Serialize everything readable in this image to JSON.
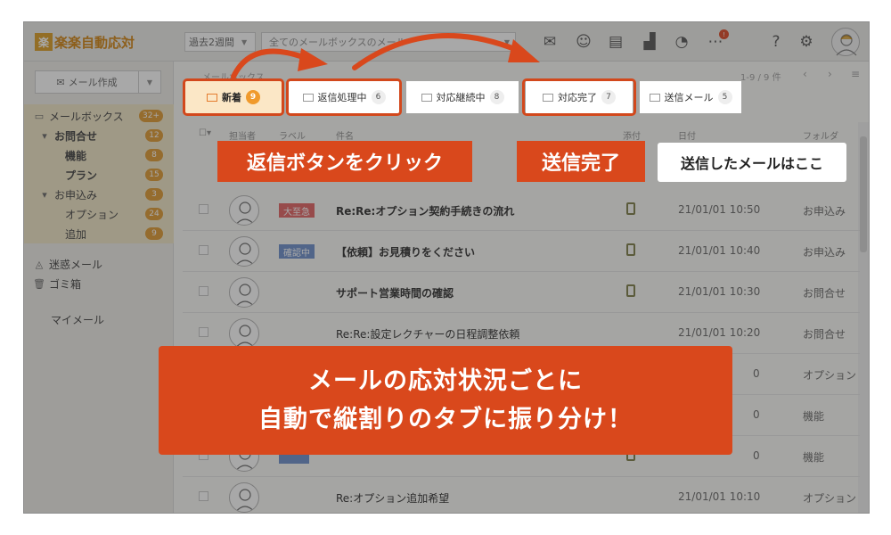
{
  "app": {
    "logo_mark": "楽",
    "logo_text": "楽楽自動応対",
    "brand_color": "#e0a83a",
    "accent_color": "#d9481c"
  },
  "topbar": {
    "period_label": "過去2週間",
    "search_placeholder": "全てのメールボックスのメール",
    "notification_badge": "!"
  },
  "sidebar": {
    "compose_label": "メール作成",
    "items": [
      {
        "label": "メールボックス",
        "count": "32+"
      },
      {
        "label": "お問合せ",
        "count": "12"
      },
      {
        "label": "機能",
        "count": "8"
      },
      {
        "label": "プラン",
        "count": "15"
      },
      {
        "label": "お申込み",
        "count": "3"
      },
      {
        "label": "オプション",
        "count": "24"
      },
      {
        "label": "追加",
        "count": "9"
      },
      {
        "label": "迷惑メール"
      },
      {
        "label": "ゴミ箱"
      },
      {
        "label": "マイメール"
      }
    ]
  },
  "mailbox": {
    "title": "メールボックス",
    "pager": "1-9 / 9 件",
    "prev": "‹",
    "next": "›",
    "tabs": [
      {
        "label": "新着",
        "count": "9"
      },
      {
        "label": "返信処理中",
        "count": "6"
      },
      {
        "label": "対応継続中",
        "count": "8"
      },
      {
        "label": "対応完了",
        "count": "7"
      },
      {
        "label": "送信メール",
        "count": "5"
      }
    ],
    "columns": [
      "担当者",
      "ラベル",
      "件名",
      "添付",
      "日付",
      "フォルダ"
    ]
  },
  "rows": [
    {
      "tag": "大至急",
      "tag_color": "#e57373",
      "subject": "Re:Re:オプション契約手続きの流れ",
      "bold": true,
      "clip": true,
      "date": "21/01/01 10:50",
      "folder": "お申込み"
    },
    {
      "tag": "確認中",
      "tag_color": "#7b9ad1",
      "subject": "【依頼】お見積りをください",
      "bold": true,
      "clip": true,
      "date": "21/01/01 10:40",
      "folder": "お申込み"
    },
    {
      "tag": "",
      "tag_color": "",
      "subject": "サポート営業時間の確認",
      "bold": true,
      "clip": true,
      "date": "21/01/01 10:30",
      "folder": "お問合せ"
    },
    {
      "tag": "",
      "tag_color": "",
      "subject": "Re:Re:設定レクチャーの日程調整依頼",
      "bold": false,
      "clip": false,
      "date": "21/01/01 10:20",
      "folder": "お問合せ"
    },
    {
      "tag": "",
      "tag_color": "",
      "subject": "",
      "bold": false,
      "clip": false,
      "date": "0",
      "folder": "オプション"
    },
    {
      "tag": "",
      "tag_color": "",
      "subject": "",
      "bold": false,
      "clip": false,
      "date": "0",
      "folder": "機能"
    },
    {
      "tag": "",
      "tag_color": "#7b9ad1",
      "subject": "",
      "bold": false,
      "clip": true,
      "date": "0",
      "folder": "機能"
    },
    {
      "tag": "",
      "tag_color": "",
      "subject": "Re:オプション追加希望",
      "bold": false,
      "clip": false,
      "date": "21/01/01 10:10",
      "folder": "オプション"
    }
  ],
  "callouts": {
    "reply_click": "返信ボタンをクリック",
    "sent_done": "送信完了",
    "sent_here": "送信したメールはここ",
    "headline_1": "メールの応対状況ごとに",
    "headline_2": "自動で縦割りのタブに振り分け！"
  }
}
